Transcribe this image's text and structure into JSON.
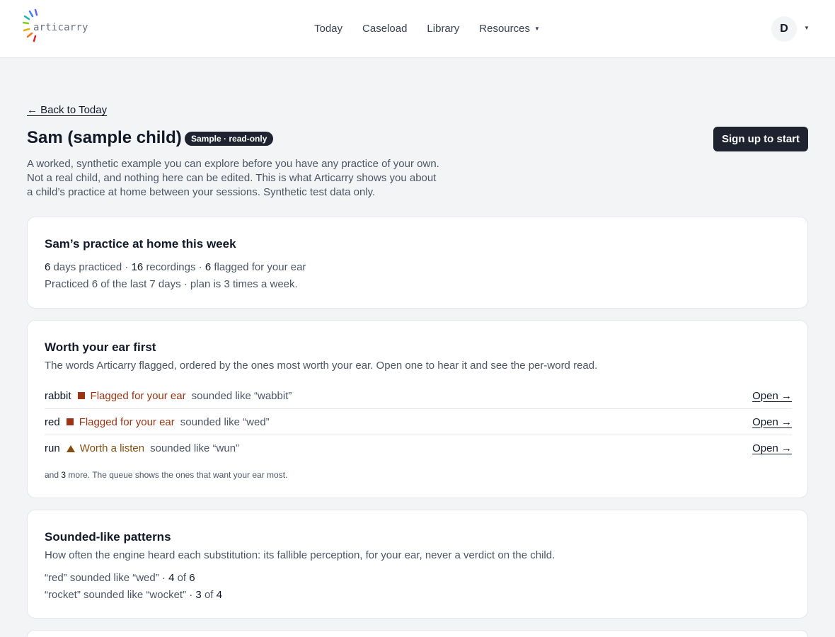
{
  "header": {
    "logo_text": "articarry",
    "nav": [
      {
        "label": "Today"
      },
      {
        "label": "Caseload"
      },
      {
        "label": "Library"
      },
      {
        "label": "Resources"
      }
    ],
    "avatar_initial": "D"
  },
  "page": {
    "back_link": "← Back to Today",
    "title": "Sam (sample child)",
    "badge": "Sample · read-only",
    "signup_button": "Sign up to start",
    "intro": "A worked, synthetic example you can explore before you have any practice of your own. Not a real child, and nothing here can be edited. This is what Articarry shows you about a child’s practice at home between your sessions. Synthetic test data only."
  },
  "practice": {
    "title": "Sam’s practice at home this week",
    "days": "6",
    "days_label": "days practiced",
    "recordings": "16",
    "recordings_label": "recordings",
    "flagged": "6",
    "flagged_label": "flagged for your ear",
    "summary": "Practiced 6 of the last 7 days · plan is 3 times a week."
  },
  "worth": {
    "title": "Worth your ear first",
    "description": "The words Articarry flagged, ordered by the ones most worth your ear. Open one to hear it and see the per-word read.",
    "items": [
      {
        "word": "rabbit",
        "status": "Flagged for your ear",
        "sounded": "sounded like “wabbit”",
        "open": "Open →"
      },
      {
        "word": "red",
        "status": "Flagged for your ear",
        "sounded": "sounded like “wed”",
        "open": "Open →"
      },
      {
        "word": "run",
        "status": "Worth a listen",
        "sounded": "sounded like “wun”",
        "open": "Open →"
      }
    ],
    "more_prefix": "and",
    "more_count": "3",
    "more_suffix": "more. The queue shows the ones that want your ear most."
  },
  "patterns": {
    "title": "Sounded-like patterns",
    "description": "How often the engine heard each substitution: its fallible perception, for your ear, never a verdict on the child.",
    "items": [
      {
        "text": "“red” sounded like “wed” ·",
        "count": "4",
        "of": "of",
        "total": "6"
      },
      {
        "text": "“rocket” sounded like “wocket” ·",
        "count": "3",
        "of": "of",
        "total": "4"
      }
    ]
  },
  "colors": {
    "flag": "#9a3412",
    "listen": "#854d0e",
    "dark": "#1f2330"
  }
}
